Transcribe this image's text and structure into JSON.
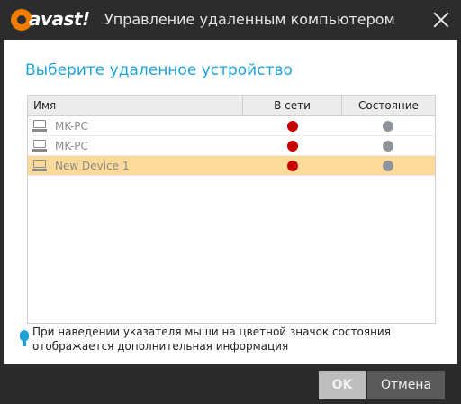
{
  "window": {
    "brand": "avast!",
    "title": "Управление удаленным компьютером"
  },
  "main": {
    "heading": "Выберите удаленное устройство",
    "columns": [
      "Имя",
      "В сети",
      "Состояние"
    ],
    "devices": [
      {
        "name": "MK-PC",
        "online_color": "#c80000",
        "state_color": "#8f939a",
        "selected": false
      },
      {
        "name": "MK-PC",
        "online_color": "#c80000",
        "state_color": "#8f939a",
        "selected": false
      },
      {
        "name": "New Device 1",
        "online_color": "#c80000",
        "state_color": "#8f939a",
        "selected": true
      }
    ],
    "hint": "При наведении указателя мыши на цветной значок состояния отображается дополнительная информация"
  },
  "footer": {
    "ok_label": "OK",
    "cancel_label": "Отмена"
  },
  "colors": {
    "accent": "#1ea2d6",
    "selected_row": "#fdd99a",
    "brand_orange": "#f07d00"
  },
  "icons": {
    "close": "close-icon",
    "device": "computer-icon",
    "hint": "lightbulb-icon"
  }
}
